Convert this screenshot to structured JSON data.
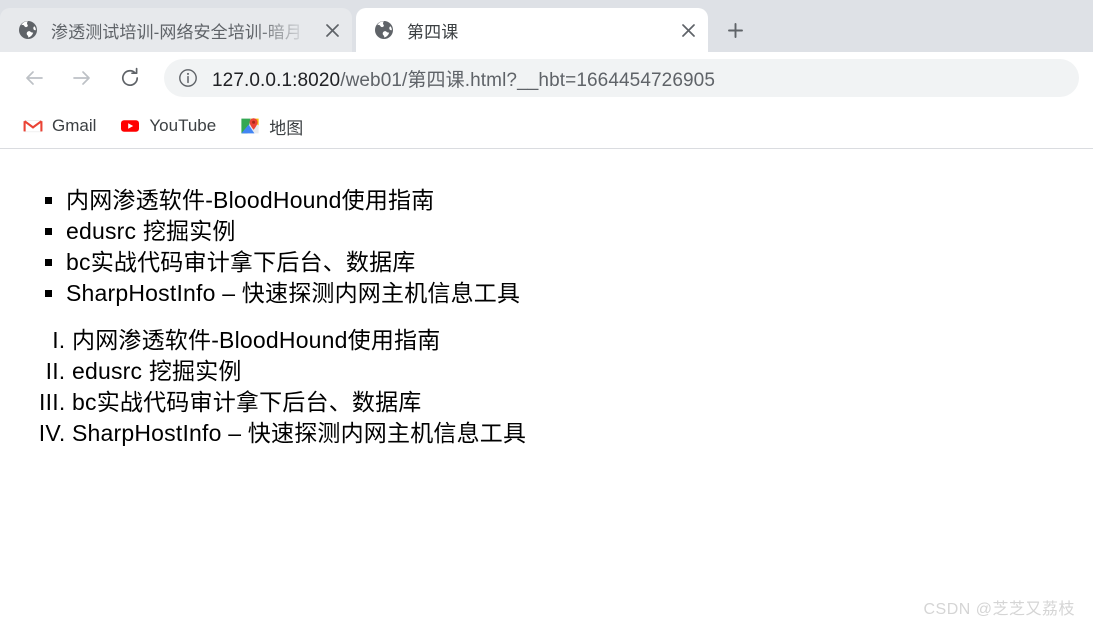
{
  "browser": {
    "tabs": [
      {
        "title": "渗透测试培训-网络安全培训-暗月",
        "favicon": "globe-icon",
        "active": false,
        "truncated": true
      },
      {
        "title": "第四课",
        "favicon": "globe-icon",
        "active": true,
        "truncated": false
      }
    ],
    "new_tab_label": "+",
    "toolbar": {
      "back": "back-arrow-icon",
      "forward": "forward-arrow-icon",
      "reload": "reload-icon",
      "site_info": "info-circle-icon",
      "url_host": "127.0.0.1:8020",
      "url_path": "/web01/第四课.html?__hbt=1664454726905",
      "url_full": "127.0.0.1:8020/web01/第四课.html?__hbt=1664454726905"
    },
    "bookmarks": [
      {
        "label": "Gmail",
        "icon": "gmail-icon"
      },
      {
        "label": "YouTube",
        "icon": "youtube-icon"
      },
      {
        "label": "地图",
        "icon": "google-maps-icon"
      }
    ]
  },
  "page": {
    "unordered_list": [
      "内网渗透软件-BloodHound使用指南",
      "edusrc 挖掘实例",
      "bc实战代码审计拿下后台、数据库",
      "SharpHostInfo – 快速探测内网主机信息工具"
    ],
    "ordered_list": [
      "内网渗透软件-BloodHound使用指南",
      "edusrc 挖掘实例",
      "bc实战代码审计拿下后台、数据库",
      "SharpHostInfo – 快速探测内网主机信息工具"
    ],
    "ordered_markers": [
      "I.",
      "II.",
      "III.",
      "IV."
    ],
    "watermark": "CSDN @芝芝又荔枝"
  },
  "colors": {
    "tabstrip_bg": "#dee1e6",
    "tab_inactive_bg": "#e7e9ec",
    "tab_active_bg": "#ffffff",
    "omnibox_bg": "#f1f3f4",
    "text_primary": "#202124",
    "text_secondary": "#5f6368",
    "gmail_red": "#ea4335",
    "youtube_red": "#ff0000",
    "watermark_gray": "#d5d5d5"
  }
}
